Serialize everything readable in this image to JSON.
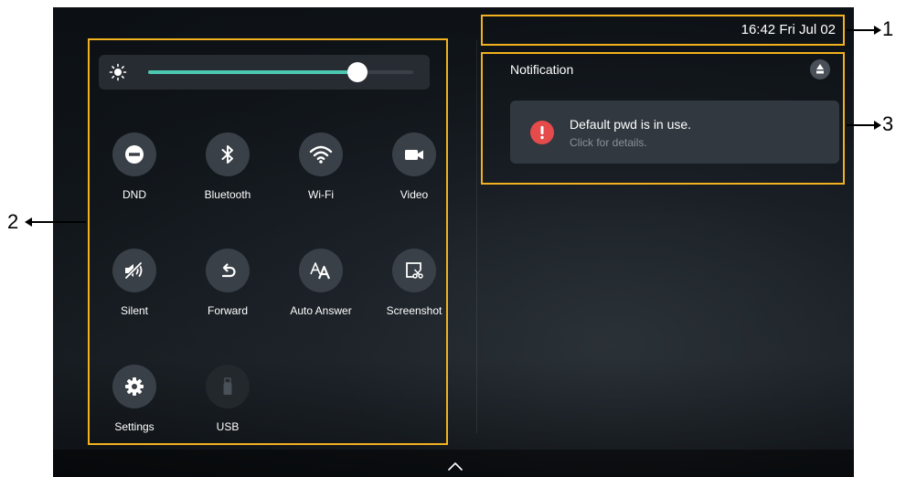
{
  "brightness": {
    "level_percent": 79
  },
  "quick_settings": [
    {
      "label": "DND",
      "icon": "dnd-icon",
      "enabled": true
    },
    {
      "label": "Bluetooth",
      "icon": "bluetooth-icon",
      "enabled": true
    },
    {
      "label": "Wi-Fi",
      "icon": "wifi-icon",
      "enabled": true
    },
    {
      "label": "Video",
      "icon": "video-icon",
      "enabled": true
    },
    {
      "label": "Silent",
      "icon": "silent-icon",
      "enabled": true
    },
    {
      "label": "Forward",
      "icon": "forward-icon",
      "enabled": true
    },
    {
      "label": "Auto Answer",
      "icon": "auto-answer-icon",
      "enabled": true
    },
    {
      "label": "Screenshot",
      "icon": "screenshot-icon",
      "enabled": true
    },
    {
      "label": "Settings",
      "icon": "settings-icon",
      "enabled": true
    },
    {
      "label": "USB",
      "icon": "usb-icon",
      "enabled": false
    }
  ],
  "status": {
    "datetime": "16:42 Fri Jul 02"
  },
  "notifications": {
    "title": "Notification",
    "items": [
      {
        "message": "Default pwd is in use.",
        "detail": "Click for details."
      }
    ]
  },
  "callouts": {
    "time": "1",
    "quick_settings": "2",
    "notifications": "3"
  },
  "colors": {
    "accent": "#4cc7b0",
    "alert": "#e54b4b",
    "annotation_frame": "#f2b11e",
    "tile_background": "#3a4047"
  }
}
